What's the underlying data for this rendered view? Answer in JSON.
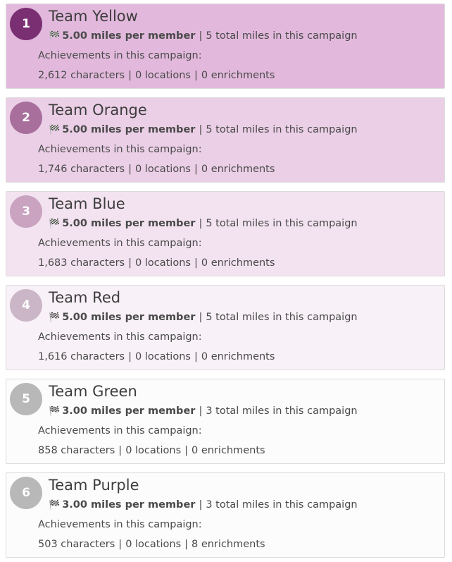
{
  "labels": {
    "per_member_suffix": "miles per member",
    "total_suffix": "total miles in this campaign",
    "achievements_heading": "Achievements in this campaign:",
    "characters_suffix": "characters",
    "locations_suffix": "locations",
    "enrichments_suffix": "enrichments",
    "separator": "|"
  },
  "colors": {
    "badges": [
      "#7a2f73",
      "#a86f9d",
      "#c9a3c0",
      "#cbb6c7",
      "#b8b8b8",
      "#b8b8b8"
    ],
    "cards": [
      "#e2b9dc",
      "#ebcfe6",
      "#f3e3f0",
      "#f8f1f7",
      "#fcfcfc",
      "#fcfcfc"
    ]
  },
  "teams": [
    {
      "rank": "1",
      "name": "Team Yellow",
      "per_member": "5.00",
      "total": "5",
      "characters": "2,612",
      "locations": "0",
      "enrichments": "0"
    },
    {
      "rank": "2",
      "name": "Team Orange",
      "per_member": "5.00",
      "total": "5",
      "characters": "1,746",
      "locations": "0",
      "enrichments": "0"
    },
    {
      "rank": "3",
      "name": "Team Blue",
      "per_member": "5.00",
      "total": "5",
      "characters": "1,683",
      "locations": "0",
      "enrichments": "0"
    },
    {
      "rank": "4",
      "name": "Team Red",
      "per_member": "5.00",
      "total": "5",
      "characters": "1,616",
      "locations": "0",
      "enrichments": "0"
    },
    {
      "rank": "5",
      "name": "Team Green",
      "per_member": "3.00",
      "total": "3",
      "characters": "858",
      "locations": "0",
      "enrichments": "0"
    },
    {
      "rank": "6",
      "name": "Team Purple",
      "per_member": "3.00",
      "total": "3",
      "characters": "503",
      "locations": "0",
      "enrichments": "8"
    }
  ]
}
